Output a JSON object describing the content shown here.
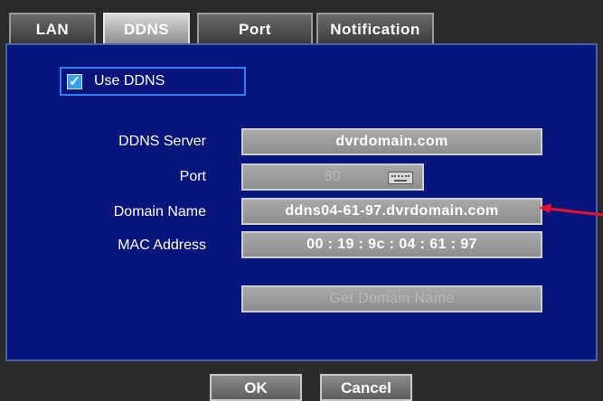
{
  "tabs": [
    {
      "label": "LAN"
    },
    {
      "label": "DDNS"
    },
    {
      "label": "Port"
    },
    {
      "label": "Notification"
    }
  ],
  "use_ddns": {
    "label": "Use DDNS",
    "checked": true
  },
  "rows": {
    "ddns_server": {
      "label": "DDNS Server",
      "value": "dvrdomain.com"
    },
    "port": {
      "label": "Port",
      "value": "80"
    },
    "domain_name": {
      "label": "Domain Name",
      "value": "ddns04-61-97.dvrdomain.com"
    },
    "mac_address": {
      "label": "MAC Address",
      "value": "00 : 19 : 9c : 04 : 61 : 97"
    }
  },
  "get_domain_button": {
    "label": "Get Domain Name"
  },
  "footer": {
    "ok_label": "OK",
    "cancel_label": "Cancel"
  },
  "colors": {
    "panel": "#07157d",
    "arrow": "#e8132a",
    "checkbox": "#36a3f0"
  },
  "icons": {
    "checkbox": "check-icon",
    "port_keyboard": "keyboard-icon",
    "annotation": "arrow-icon"
  }
}
